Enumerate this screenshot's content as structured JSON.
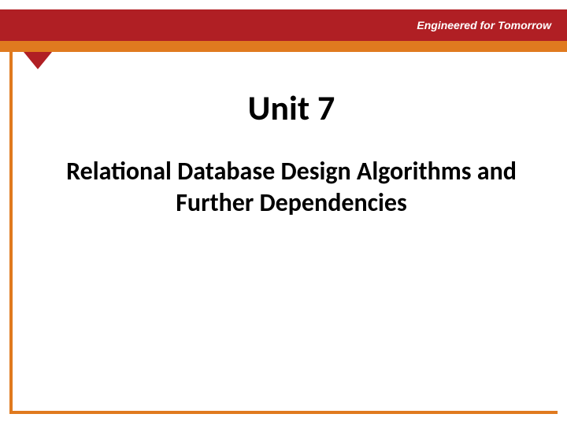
{
  "header": {
    "tagline": "Engineered for Tomorrow"
  },
  "content": {
    "unit_title": "Unit 7",
    "subtitle": "Relational Database Design Algorithms and Further Dependencies"
  },
  "theme": {
    "primary_color": "#b01f24",
    "accent_color": "#e07a1f",
    "text_color": "#000000",
    "tagline_color": "#ffffff"
  }
}
